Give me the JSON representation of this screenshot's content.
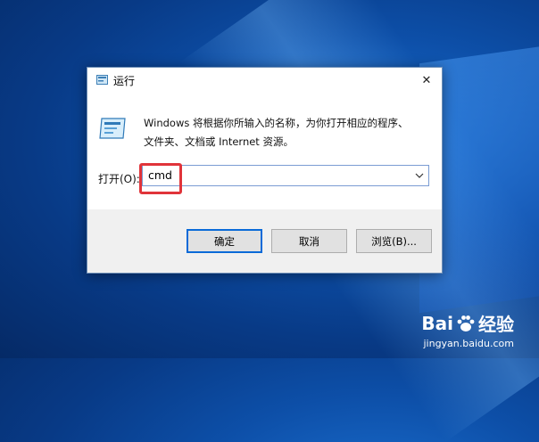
{
  "window": {
    "title": "运行",
    "close_glyph": "✕"
  },
  "description": {
    "line1": "Windows 将根据你所输入的名称，为你打开相应的程序、",
    "line2": "文件夹、文档或 Internet 资源。"
  },
  "open_field": {
    "label": "打开(O):",
    "value": "cmd"
  },
  "buttons": {
    "ok": "确定",
    "cancel": "取消",
    "browse": "浏览(B)..."
  },
  "watermark": {
    "brand_left": "Bai",
    "brand_right": "经验",
    "url": "jingyan.baidu.com"
  },
  "colors": {
    "accent": "#0a6ad8",
    "highlight": "#e0343a",
    "desktop": "#0d4fa8"
  }
}
